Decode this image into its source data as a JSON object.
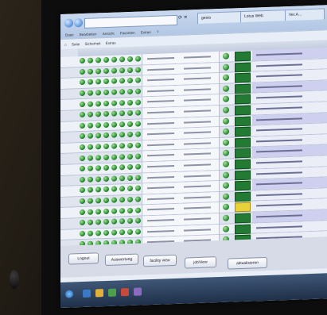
{
  "browser": {
    "tabs": [
      "gesia",
      "Lotus Web",
      "Ver.A..."
    ],
    "menu": [
      "Datei",
      "Bearbeiten",
      "Ansicht",
      "Favoriten",
      "Extras",
      "?"
    ],
    "toolbar": [
      "Seite",
      "Sicherheit",
      "Extras"
    ]
  },
  "actions": {
    "buttons": [
      "Logout",
      "Auswertung",
      "facility view",
      "jobView",
      "aktualisieren"
    ]
  },
  "colors": {
    "status_ok": "#237a33",
    "status_warn": "#e8d23a",
    "status_error": "#c8282c",
    "led_green": "#167a22"
  },
  "icons": [
    "back-icon",
    "forward-icon",
    "refresh-icon",
    "windows-start-icon"
  ]
}
